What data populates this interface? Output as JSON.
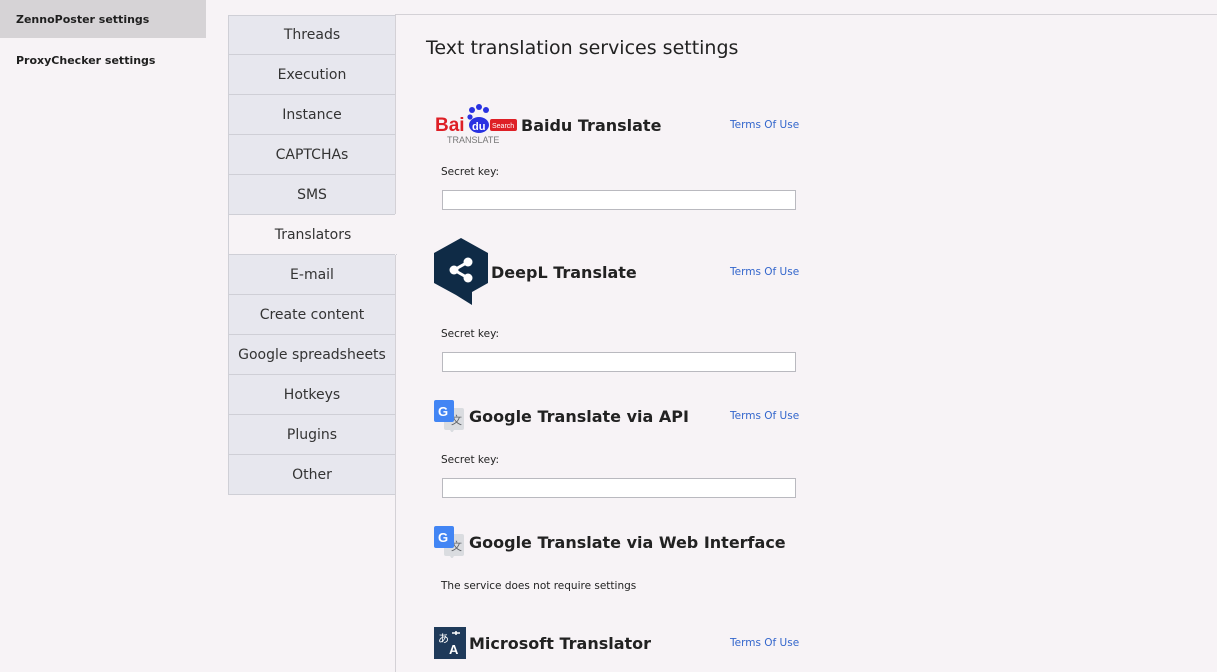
{
  "left_nav": [
    {
      "label": "ZennoPoster settings",
      "active": true
    },
    {
      "label": "ProxyChecker settings",
      "active": false
    }
  ],
  "tabs": [
    {
      "label": "Threads"
    },
    {
      "label": "Execution"
    },
    {
      "label": "Instance"
    },
    {
      "label": "CAPTCHAs"
    },
    {
      "label": "SMS"
    },
    {
      "label": "Translators",
      "active": true
    },
    {
      "label": "E-mail"
    },
    {
      "label": "Create content"
    },
    {
      "label": "Google spreadsheets"
    },
    {
      "label": "Hotkeys"
    },
    {
      "label": "Plugins"
    },
    {
      "label": "Other"
    }
  ],
  "page": {
    "title": "Text translation services settings"
  },
  "services": {
    "baidu": {
      "title": "Baidu Translate",
      "terms": "Terms Of Use",
      "key_label": "Secret key:",
      "key_value": "",
      "logo": {
        "bai": "Bai",
        "du": "du",
        "badge": "Search",
        "sub": "TRANSLATE"
      }
    },
    "deepl": {
      "title": "DeepL Translate",
      "terms": "Terms Of Use",
      "key_label": "Secret key:",
      "key_value": ""
    },
    "google_api": {
      "title": "Google Translate via API",
      "terms": "Terms Of Use",
      "key_label": "Secret key:",
      "key_value": ""
    },
    "google_web": {
      "title": "Google Translate via Web Interface",
      "note": "The service does not require settings"
    },
    "microsoft": {
      "title": "Microsoft Translator",
      "terms": "Terms Of Use"
    }
  },
  "colors": {
    "baidu_red": "#de1f26",
    "baidu_blue": "#2932e1",
    "deepl_navy": "#0f2b46",
    "google_blue": "#4285f4",
    "microsoft_navy": "#1f3a5a",
    "link": "#3366cc"
  },
  "icons": [
    "baidu-logo",
    "deepl-logo",
    "google-translate-icon",
    "microsoft-translator-icon"
  ]
}
